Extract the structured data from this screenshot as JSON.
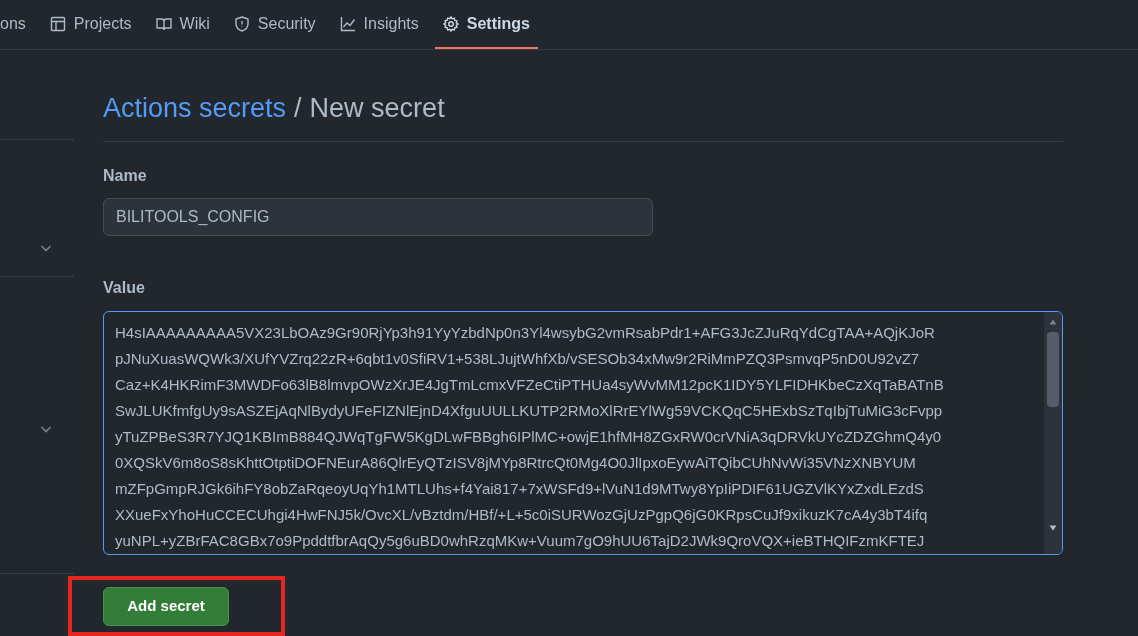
{
  "tabs": [
    {
      "label": "ons",
      "kind": "none",
      "selected": false
    },
    {
      "label": "Projects",
      "kind": "table",
      "selected": false
    },
    {
      "label": "Wiki",
      "kind": "book",
      "selected": false
    },
    {
      "label": "Security",
      "kind": "shield",
      "selected": false
    },
    {
      "label": "Insights",
      "kind": "graph",
      "selected": false
    },
    {
      "label": "Settings",
      "kind": "gear",
      "selected": true
    }
  ],
  "heading": {
    "link": "Actions secrets",
    "separator": "/",
    "title": "New secret"
  },
  "name_field": {
    "label": "Name",
    "value": "BILITOOLS_CONFIG"
  },
  "value_field": {
    "label": "Value",
    "lines": [
      "H4sIAAAAAAAAA5VX23LbOAz9Gr90RjYp3h91YyYzbdNp0n3Yl4wsybG2vmRsabPdr1+AFG3JcZJuRqYdCgTAA+AQjKJoR",
      "pJNuXuasWQWk3/XUfYVZrq22zR+6qbt1v0SfiRV1+538LJujtWhfXb/vSESOb34xMw9r2RiMmPZQ3PsmvqP5nD0U92vZ7",
      "Caz+K4HKRimF3MWDFo63lB8lmvpOWzXrJE4JgTmLcmxVFZeCtiPTHUa4syWvMM12pcK1IDY5YLFIDHKbeCzXqTaBATnB",
      "SwJLUKfmfgUy9sASZEjAqNlBydyUFeFIZNlEjnD4XfguUULLKUTP2RMoXlRrEYlWg59VCKQqC5HExbSzTqIbjTuMiG3cFvpp",
      "yTuZPBeS3R7YJQ1KBImB884QJWqTgFW5KgDLwFBBgh6IPlMC+owjE1hfMH8ZGxRW0crVNiA3qDRVkUYcZDZGhmQ4y0",
      "0XQSkV6m8oS8sKhttOtptiDOFNEurA86QlrEyQTzISV8jMYp8RtrcQt0Mg4O0JlIpxoEywAiTQibCUhNvWi35VNzXNBYUM",
      "mZFpGmpRJGk6ihFY8obZaRqeoyUqYh1MTLUhs+f4Yai817+7xWSFd9+lVuN1d9MTwy8YpIiPDIF61UGZVlKYxZxdLEzdS",
      "XXueFxYhoHuCCECUhgi4HwFNJ5k/OvcXL/vBztdm/HBf/+L+5c0iSURWozGjUzPgpQ6jG0KRpsCuJf9xikuzK7cA4y3bT4ifq",
      "yuNPL+yZBrFAC8GBx7o9PpddtfbrAqQy5g6uBD0whRzqMKw+Vuum7gO9hUU6TajD2JWk9QroVQX+ieBTHQIFzmKFTEJ"
    ]
  },
  "submit_button": {
    "label": "Add secret"
  }
}
